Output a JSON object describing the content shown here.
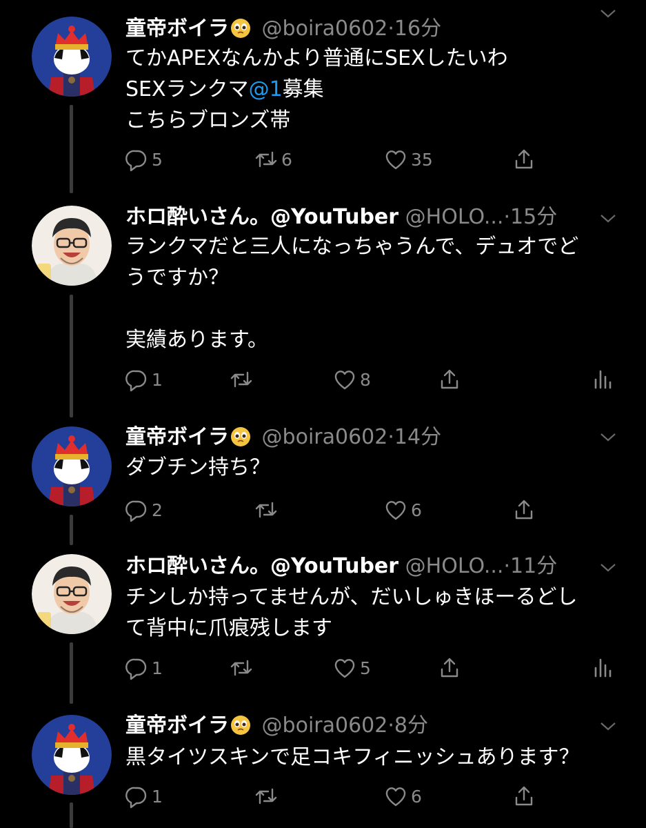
{
  "tweets": [
    {
      "name": "童帝ボイラ",
      "handle": "@boira0602",
      "time": "16分",
      "avatar": "king-avatar",
      "body_pre": "てかAPEXなんかより普通にSEXしたいわ\nSEXランクマ",
      "mention": "@1",
      "body_post": "募集\nこちらブロンズ帯",
      "replies": "5",
      "retweets": "6",
      "likes": "35",
      "has_analytics": false
    },
    {
      "name": "ホロ酔いさん。@YouTuber",
      "handle": "@HOLO...",
      "time": "15分",
      "avatar": "man-avatar",
      "body_pre": "ランクマだと三人になっちゃうんで、デュオでど\nうですか？\n\n実績あります。",
      "replies": "1",
      "retweets": "",
      "likes": "8",
      "has_analytics": true
    },
    {
      "name": "童帝ボイラ",
      "handle": "@boira0602",
      "time": "14分",
      "avatar": "king-avatar",
      "body_pre": "ダブチン持ち？",
      "replies": "2",
      "retweets": "",
      "likes": "6",
      "has_analytics": false
    },
    {
      "name": "ホロ酔いさん。@YouTuber",
      "handle": "@HOLO...",
      "time": "11分",
      "avatar": "man-avatar",
      "body_pre": "チンしか持ってませんが、だいしゅきほーるどし\nて背中に爪痕残します",
      "replies": "1",
      "retweets": "",
      "likes": "5",
      "has_analytics": true
    },
    {
      "name": "童帝ボイラ",
      "handle": "@boira0602",
      "time": "8分",
      "avatar": "king-avatar",
      "body_pre": "黒タイツスキンで足コキフィニッシュあります？",
      "replies": "1",
      "retweets": "",
      "likes": "6",
      "has_analytics": false
    }
  ],
  "icons": {
    "reply": "reply-icon",
    "retweet": "retweet-icon",
    "like": "heart-icon",
    "share": "share-icon",
    "analytics": "analytics-icon",
    "menu": "chevron-down-icon",
    "emoji": "pleading-face-emoji"
  },
  "colors": {
    "background": "#000000",
    "text": "#ffffff",
    "meta": "#8a8a8a",
    "mention": "#1d9bf0",
    "avatar_king_bg": "#233f9a"
  }
}
